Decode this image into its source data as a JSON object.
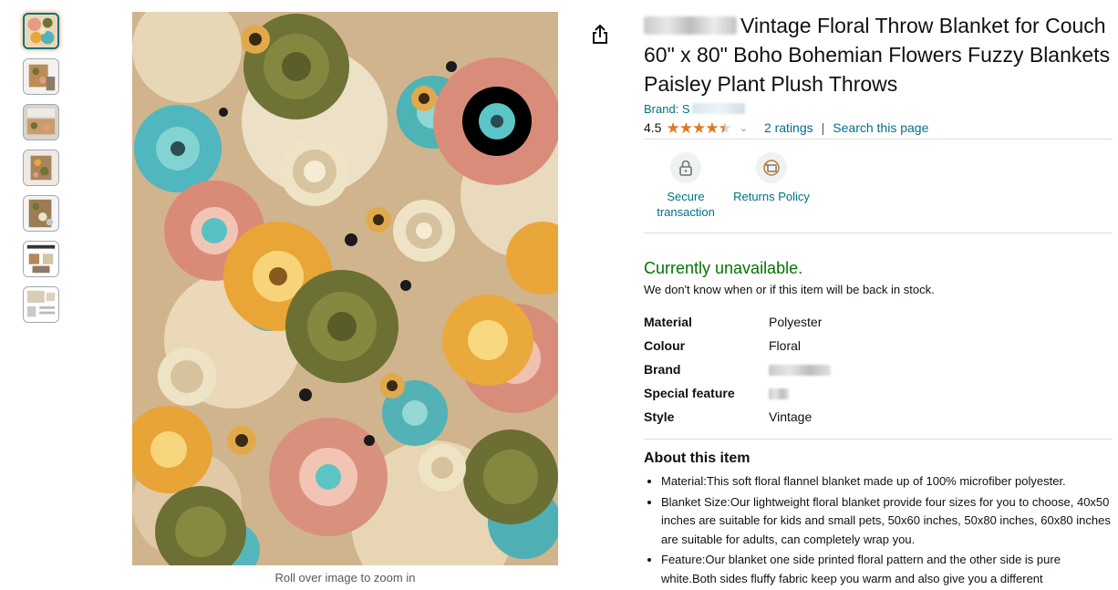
{
  "thumbnails": [
    {
      "label": "thumb-1"
    },
    {
      "label": "thumb-2"
    },
    {
      "label": "thumb-3"
    },
    {
      "label": "thumb-4"
    },
    {
      "label": "thumb-5"
    },
    {
      "label": "thumb-6"
    },
    {
      "label": "thumb-7"
    }
  ],
  "image": {
    "zoom_hint": "Roll over image to zoom in"
  },
  "product": {
    "title_rest": "Vintage Floral Throw Blanket for Couch 60\" x 80\" Boho Bohemian Flowers Fuzzy Blankets Paisley Plant Plush Throws",
    "brand_prefix": "Brand: S",
    "rating_value": "4.5",
    "rating_stars": 4.5,
    "ratings_link": "2 ratings",
    "separator": "|",
    "search_link": "Search this page"
  },
  "badges": {
    "secure": "Secure transaction",
    "returns": "Returns Policy"
  },
  "availability": {
    "status": "Currently unavailable.",
    "note": "We don't know when or if this item will be back in stock."
  },
  "specs": [
    {
      "key": "Material",
      "value": "Polyester"
    },
    {
      "key": "Colour",
      "value": "Floral"
    },
    {
      "key": "Brand",
      "value": ""
    },
    {
      "key": "Special feature",
      "value": ""
    },
    {
      "key": "Style",
      "value": "Vintage"
    }
  ],
  "about": {
    "heading": "About this item",
    "bullets": [
      "Material:This soft floral flannel blanket made up of 100% microfiber polyester.",
      "Blanket Size:Our lightweight floral blanket provide four sizes for you to choose, 40x50 inches are suitable for kids and small pets, 50x60 inches, 50x80 inches, 60x80 inches are suitable for adults, can completely wrap you.",
      "Feature:Our blanket one side printed floral pattern and the other side is pure white.Both sides fluffy fabric keep you warm and also give you a different"
    ]
  },
  "colors": {
    "link": "#007185",
    "available_green": "#007600",
    "star": "#de7921",
    "text": "#0f1111"
  }
}
